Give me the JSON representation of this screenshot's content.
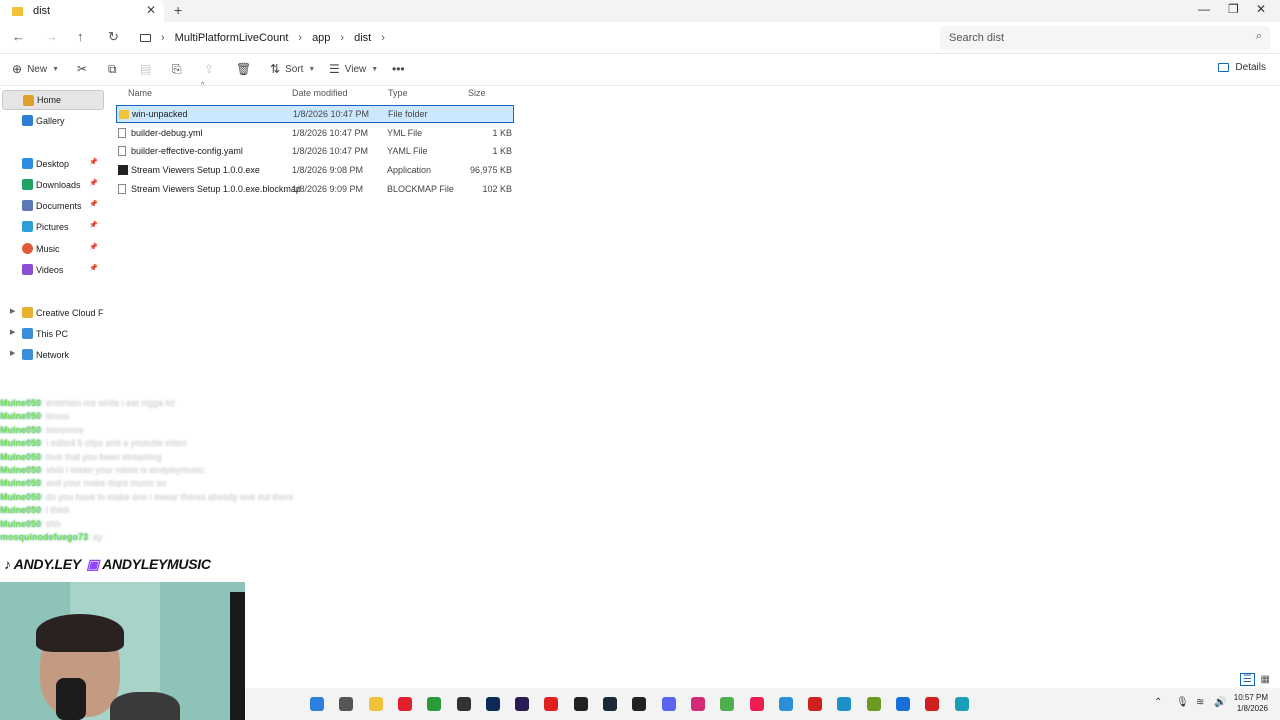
{
  "window": {
    "tab_title": "dist",
    "tab_close": "✕",
    "new_tab": "+",
    "minimize": "—",
    "maximize": "❐",
    "close": "✕"
  },
  "nav": {
    "back": "←",
    "forward": "→",
    "up": "↑",
    "refresh": "↻",
    "breadcrumb": [
      "MultiPlatformLiveCount",
      "app",
      "dist"
    ],
    "search_placeholder": "Search dist"
  },
  "toolbar": {
    "new_label": "New",
    "sort_label": "Sort",
    "view_label": "View",
    "more": "•••",
    "details_label": "Details"
  },
  "sidebar": {
    "items": [
      {
        "label": "Home",
        "icon": "home-icon",
        "color": "#e0a030"
      },
      {
        "label": "Gallery",
        "icon": "gallery-icon",
        "color": "#2d7fd3"
      },
      {
        "label": "Desktop",
        "icon": "desktop-icon",
        "color": "#2d8ee0",
        "pinned": true
      },
      {
        "label": "Downloads",
        "icon": "downloads-icon",
        "color": "#1fa463",
        "pinned": true
      },
      {
        "label": "Documents",
        "icon": "documents-icon",
        "color": "#5a7bb5",
        "pinned": true
      },
      {
        "label": "Pictures",
        "icon": "pictures-icon",
        "color": "#2a9fd8",
        "pinned": true
      },
      {
        "label": "Music",
        "icon": "music-icon",
        "color": "#e05a3a",
        "pinned": true
      },
      {
        "label": "Videos",
        "icon": "videos-icon",
        "color": "#8b4fd4",
        "pinned": true
      },
      {
        "label": "Creative Cloud File",
        "icon": "creative-cloud-icon",
        "color": "#e8b030"
      },
      {
        "label": "This PC",
        "icon": "pc-icon",
        "color": "#3a8fd8"
      },
      {
        "label": "Network",
        "icon": "network-icon",
        "color": "#3a8fd8"
      }
    ]
  },
  "columns": {
    "name": "Name",
    "date": "Date modified",
    "type": "Type",
    "size": "Size"
  },
  "files": [
    {
      "name": "win-unpacked",
      "date": "1/8/2026 10:47 PM",
      "type": "File folder",
      "size": "",
      "icon": "folder-icon"
    },
    {
      "name": "builder-debug.yml",
      "date": "1/8/2026 10:47 PM",
      "type": "YML File",
      "size": "1 KB",
      "icon": "file-icon"
    },
    {
      "name": "builder-effective-config.yaml",
      "date": "1/8/2026 10:47 PM",
      "type": "YAML File",
      "size": "1 KB",
      "icon": "file-icon"
    },
    {
      "name": "Stream Viewers Setup 1.0.0.exe",
      "date": "1/8/2026 9:08 PM",
      "type": "Application",
      "size": "96,975 KB",
      "icon": "exe-icon"
    },
    {
      "name": "Stream Viewers Setup 1.0.0.exe.blockmap",
      "date": "1/8/2026 9:09 PM",
      "type": "BLOCKMAP File",
      "size": "102 KB",
      "icon": "file-icon"
    }
  ],
  "chat": [
    {
      "user": "Mulne050",
      "msg": ": entertain me while i eat nigga lol"
    },
    {
      "user": "Mulne050",
      "msg": ": bruuu"
    },
    {
      "user": "Mulne050",
      "msg": ": tomorrow"
    },
    {
      "user": "Mulne050",
      "msg": ": i edited 5 clips and a youtube video"
    },
    {
      "user": "Mulne050",
      "msg": ": love that you been streaming"
    },
    {
      "user": "Mulne050",
      "msg": ": shiiii i mean your name is andyleymusic"
    },
    {
      "user": "Mulne050",
      "msg": ": and your make dope music so"
    },
    {
      "user": "Mulne050",
      "msg": ": do you have to make one i swear theres already one out there"
    },
    {
      "user": "Mulne050",
      "msg": ": i think"
    },
    {
      "user": "Mulne050",
      "msg": ": shh"
    },
    {
      "user": "mosquinodefuego73",
      "msg": ": ay"
    }
  ],
  "overlay": {
    "tiktok": "ANDY.LEY",
    "twitch": "ANDYLEYMUSIC"
  },
  "taskbar": {
    "time": "10:57 PM",
    "date": "1/8/2026",
    "apps": [
      {
        "name": "start-icon",
        "color": "#2f7fe0"
      },
      {
        "name": "terminal-icon",
        "color": "#555555"
      },
      {
        "name": "file-explorer-icon",
        "color": "#f2c23a"
      },
      {
        "name": "opera-icon",
        "color": "#e0202a"
      },
      {
        "name": "xbox-icon",
        "color": "#2d9a3a"
      },
      {
        "name": "app-icon",
        "color": "#333333"
      },
      {
        "name": "photoshop-icon",
        "color": "#0a2a55"
      },
      {
        "name": "premiere-icon",
        "color": "#2a1a55"
      },
      {
        "name": "youtube-music-icon",
        "color": "#e02020"
      },
      {
        "name": "obs-icon",
        "color": "#222222"
      },
      {
        "name": "steam-icon",
        "color": "#1b2838"
      },
      {
        "name": "chatgpt-icon",
        "color": "#222222"
      },
      {
        "name": "discord-icon",
        "color": "#5865f2"
      },
      {
        "name": "instagram-icon",
        "color": "#d62976"
      },
      {
        "name": "chrome-icon",
        "color": "#4caf50"
      },
      {
        "name": "tiktok-icon",
        "color": "#ee1d52"
      },
      {
        "name": "vscode-icon",
        "color": "#2a8fd8"
      },
      {
        "name": "game-icon",
        "color": "#d02020"
      },
      {
        "name": "edge-icon",
        "color": "#1a8fc8"
      },
      {
        "name": "notes-icon",
        "color": "#6a9a20"
      },
      {
        "name": "cursor-icon",
        "color": "#1a6fd8"
      },
      {
        "name": "capture-icon",
        "color": "#d02020"
      },
      {
        "name": "edge2-icon",
        "color": "#1a9fb8"
      }
    ]
  }
}
